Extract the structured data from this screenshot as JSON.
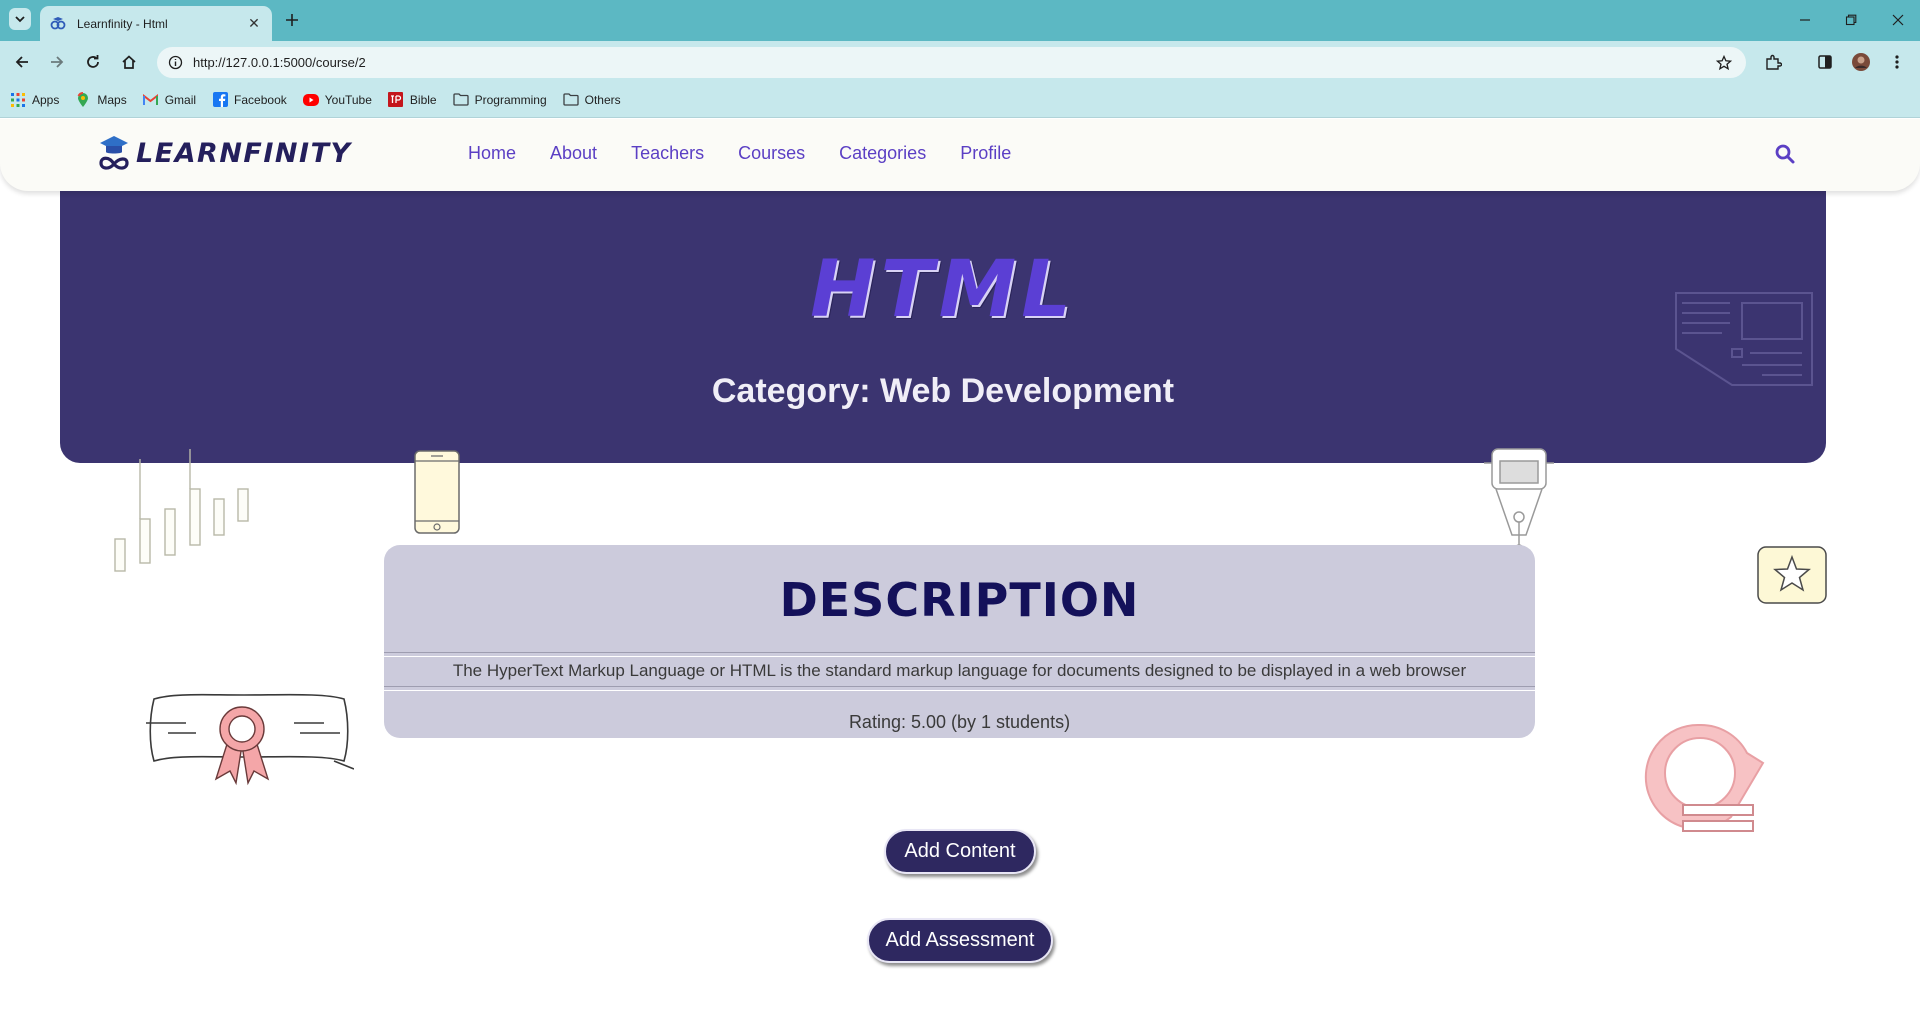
{
  "browser": {
    "tab_title": "Learnfinity - Html",
    "url": "http://127.0.0.1:5000/course/2",
    "bookmarks": [
      {
        "label": "Apps",
        "icon": "apps-grid-icon"
      },
      {
        "label": "Maps",
        "icon": "maps-pin-icon"
      },
      {
        "label": "Gmail",
        "icon": "gmail-icon"
      },
      {
        "label": "Facebook",
        "icon": "facebook-icon"
      },
      {
        "label": "YouTube",
        "icon": "youtube-icon"
      },
      {
        "label": "Bible",
        "icon": "bible-icon"
      },
      {
        "label": "Programming",
        "icon": "folder-icon"
      },
      {
        "label": "Others",
        "icon": "folder-icon"
      }
    ]
  },
  "site": {
    "logo_text": "LEARNFINITY",
    "nav": [
      "Home",
      "About",
      "Teachers",
      "Courses",
      "Categories",
      "Profile"
    ]
  },
  "course": {
    "title": "HTML",
    "category": "Category: Web Development",
    "description_heading": "DESCRIPTION",
    "description": "The HyperText Markup Language or HTML is the standard markup language for documents designed to be displayed in a web browser",
    "rating": "Rating: 5.00 (by 1 students)"
  },
  "actions": {
    "add_content": "Add Content",
    "add_assessment": "Add Assessment"
  },
  "colors": {
    "chrome_tabstrip": "#5cb8c3",
    "chrome_toolbar": "#c6e8ec",
    "hero_bg": "#3b3470",
    "accent_purple": "#5b3fc4",
    "button_bg": "#2e2860",
    "card_bg": "#cccbdc"
  }
}
